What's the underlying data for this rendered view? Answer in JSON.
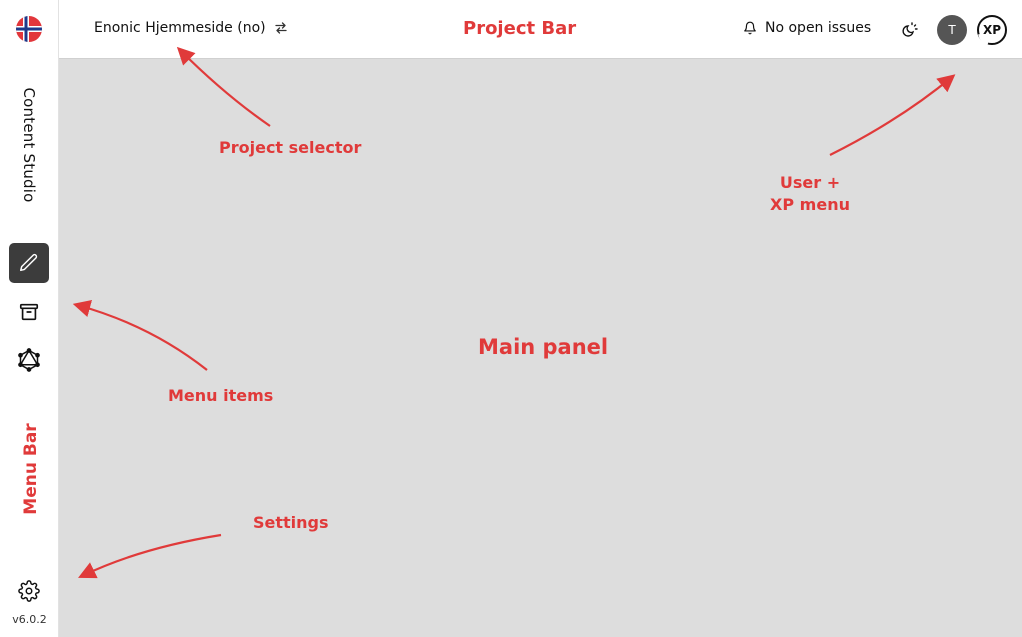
{
  "sidebar": {
    "app_name": "Content Studio",
    "version": "v6.0.2",
    "items": [
      {
        "name": "edit",
        "icon": "pencil-icon",
        "active": true
      },
      {
        "name": "archive",
        "icon": "archive-icon",
        "active": false
      },
      {
        "name": "graphql",
        "icon": "graphql-icon",
        "active": false
      }
    ],
    "settings_icon": "gear-icon"
  },
  "topbar": {
    "project_name": "Enonic Hjemmeside (no)",
    "issues_label": "No open issues",
    "user_initial": "T",
    "xp_label": "XP"
  },
  "annotations": {
    "project_bar": "Project Bar",
    "project_selector": "Project selector",
    "user_xp_menu_line1": "User +",
    "user_xp_menu_line2": "XP menu",
    "main_panel": "Main panel",
    "menu_items": "Menu items",
    "menu_bar": "Menu Bar",
    "settings": "Settings"
  },
  "colors": {
    "annotation": "#e03a3a",
    "active_nav": "#3c3c3c",
    "main_panel_bg": "#dddddd"
  }
}
